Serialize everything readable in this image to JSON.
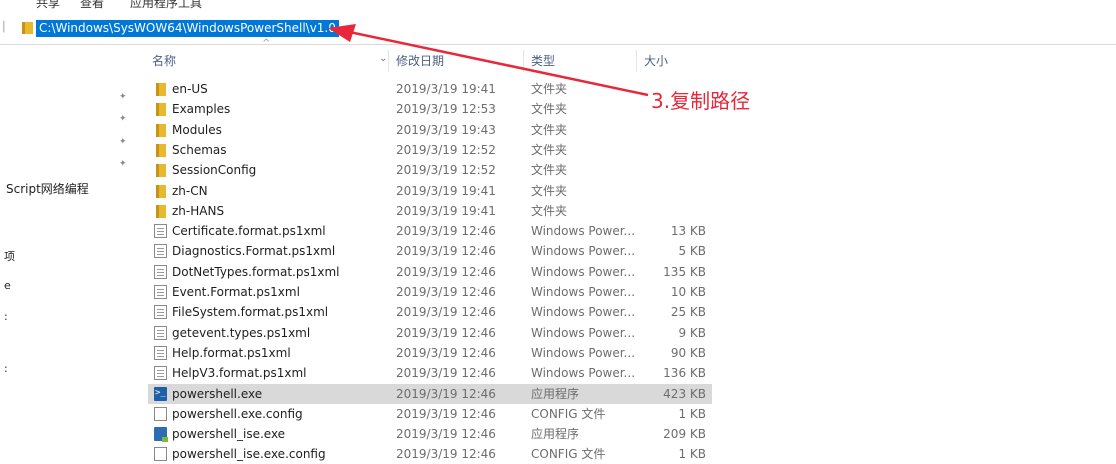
{
  "ribbon": {
    "tabs": [
      "共享",
      "查看",
      "应用程序工具"
    ]
  },
  "address_bar": {
    "path": "C:\\Windows\\SysWOW64\\WindowsPowerShell\\v1.0"
  },
  "columns": {
    "name": "名称",
    "date": "修改日期",
    "type": "类型",
    "size": "大小"
  },
  "nav_pane": {
    "item": "Script网络编程",
    "frag1": "项",
    "frag2": "e",
    "frag3": ":",
    "frag4": ":"
  },
  "files": [
    {
      "name": "en-US",
      "date": "2019/3/19 19:41",
      "type": "文件夹",
      "size": "",
      "icon": "folder-icon"
    },
    {
      "name": "Examples",
      "date": "2019/3/19 12:53",
      "type": "文件夹",
      "size": "",
      "icon": "folder-icon"
    },
    {
      "name": "Modules",
      "date": "2019/3/19 19:43",
      "type": "文件夹",
      "size": "",
      "icon": "folder-icon"
    },
    {
      "name": "Schemas",
      "date": "2019/3/19 12:52",
      "type": "文件夹",
      "size": "",
      "icon": "folder-icon"
    },
    {
      "name": "SessionConfig",
      "date": "2019/3/19 12:52",
      "type": "文件夹",
      "size": "",
      "icon": "folder-icon"
    },
    {
      "name": "zh-CN",
      "date": "2019/3/19 19:41",
      "type": "文件夹",
      "size": "",
      "icon": "folder-icon"
    },
    {
      "name": "zh-HANS",
      "date": "2019/3/19 19:41",
      "type": "文件夹",
      "size": "",
      "icon": "folder-icon"
    },
    {
      "name": "Certificate.format.ps1xml",
      "date": "2019/3/19 12:46",
      "type": "Windows Power...",
      "size": "13 KB",
      "icon": "document-icon"
    },
    {
      "name": "Diagnostics.Format.ps1xml",
      "date": "2019/3/19 12:46",
      "type": "Windows Power...",
      "size": "5 KB",
      "icon": "document-icon"
    },
    {
      "name": "DotNetTypes.format.ps1xml",
      "date": "2019/3/19 12:46",
      "type": "Windows Power...",
      "size": "135 KB",
      "icon": "document-icon"
    },
    {
      "name": "Event.Format.ps1xml",
      "date": "2019/3/19 12:46",
      "type": "Windows Power...",
      "size": "10 KB",
      "icon": "document-icon"
    },
    {
      "name": "FileSystem.format.ps1xml",
      "date": "2019/3/19 12:46",
      "type": "Windows Power...",
      "size": "25 KB",
      "icon": "document-icon"
    },
    {
      "name": "getevent.types.ps1xml",
      "date": "2019/3/19 12:46",
      "type": "Windows Power...",
      "size": "9 KB",
      "icon": "document-icon"
    },
    {
      "name": "Help.format.ps1xml",
      "date": "2019/3/19 12:46",
      "type": "Windows Power...",
      "size": "90 KB",
      "icon": "document-icon"
    },
    {
      "name": "HelpV3.format.ps1xml",
      "date": "2019/3/19 12:46",
      "type": "Windows Power...",
      "size": "136 KB",
      "icon": "document-icon"
    },
    {
      "name": "powershell.exe",
      "date": "2019/3/19 12:46",
      "type": "应用程序",
      "size": "423 KB",
      "icon": "powershell-icon",
      "selected": true
    },
    {
      "name": "powershell.exe.config",
      "date": "2019/3/19 12:46",
      "type": "CONFIG 文件",
      "size": "1 KB",
      "icon": "blank-file-icon"
    },
    {
      "name": "powershell_ise.exe",
      "date": "2019/3/19 12:46",
      "type": "应用程序",
      "size": "209 KB",
      "icon": "powershell-ise-icon"
    },
    {
      "name": "powershell_ise.exe.config",
      "date": "2019/3/19 12:46",
      "type": "CONFIG 文件",
      "size": "1 KB",
      "icon": "blank-file-icon"
    }
  ],
  "annotation": {
    "text": "3.复制路径",
    "color": "#e8283a"
  },
  "colors": {
    "selection": "#0078d7",
    "row_selected": "#d9d9d9",
    "folder": "#e7b931"
  }
}
